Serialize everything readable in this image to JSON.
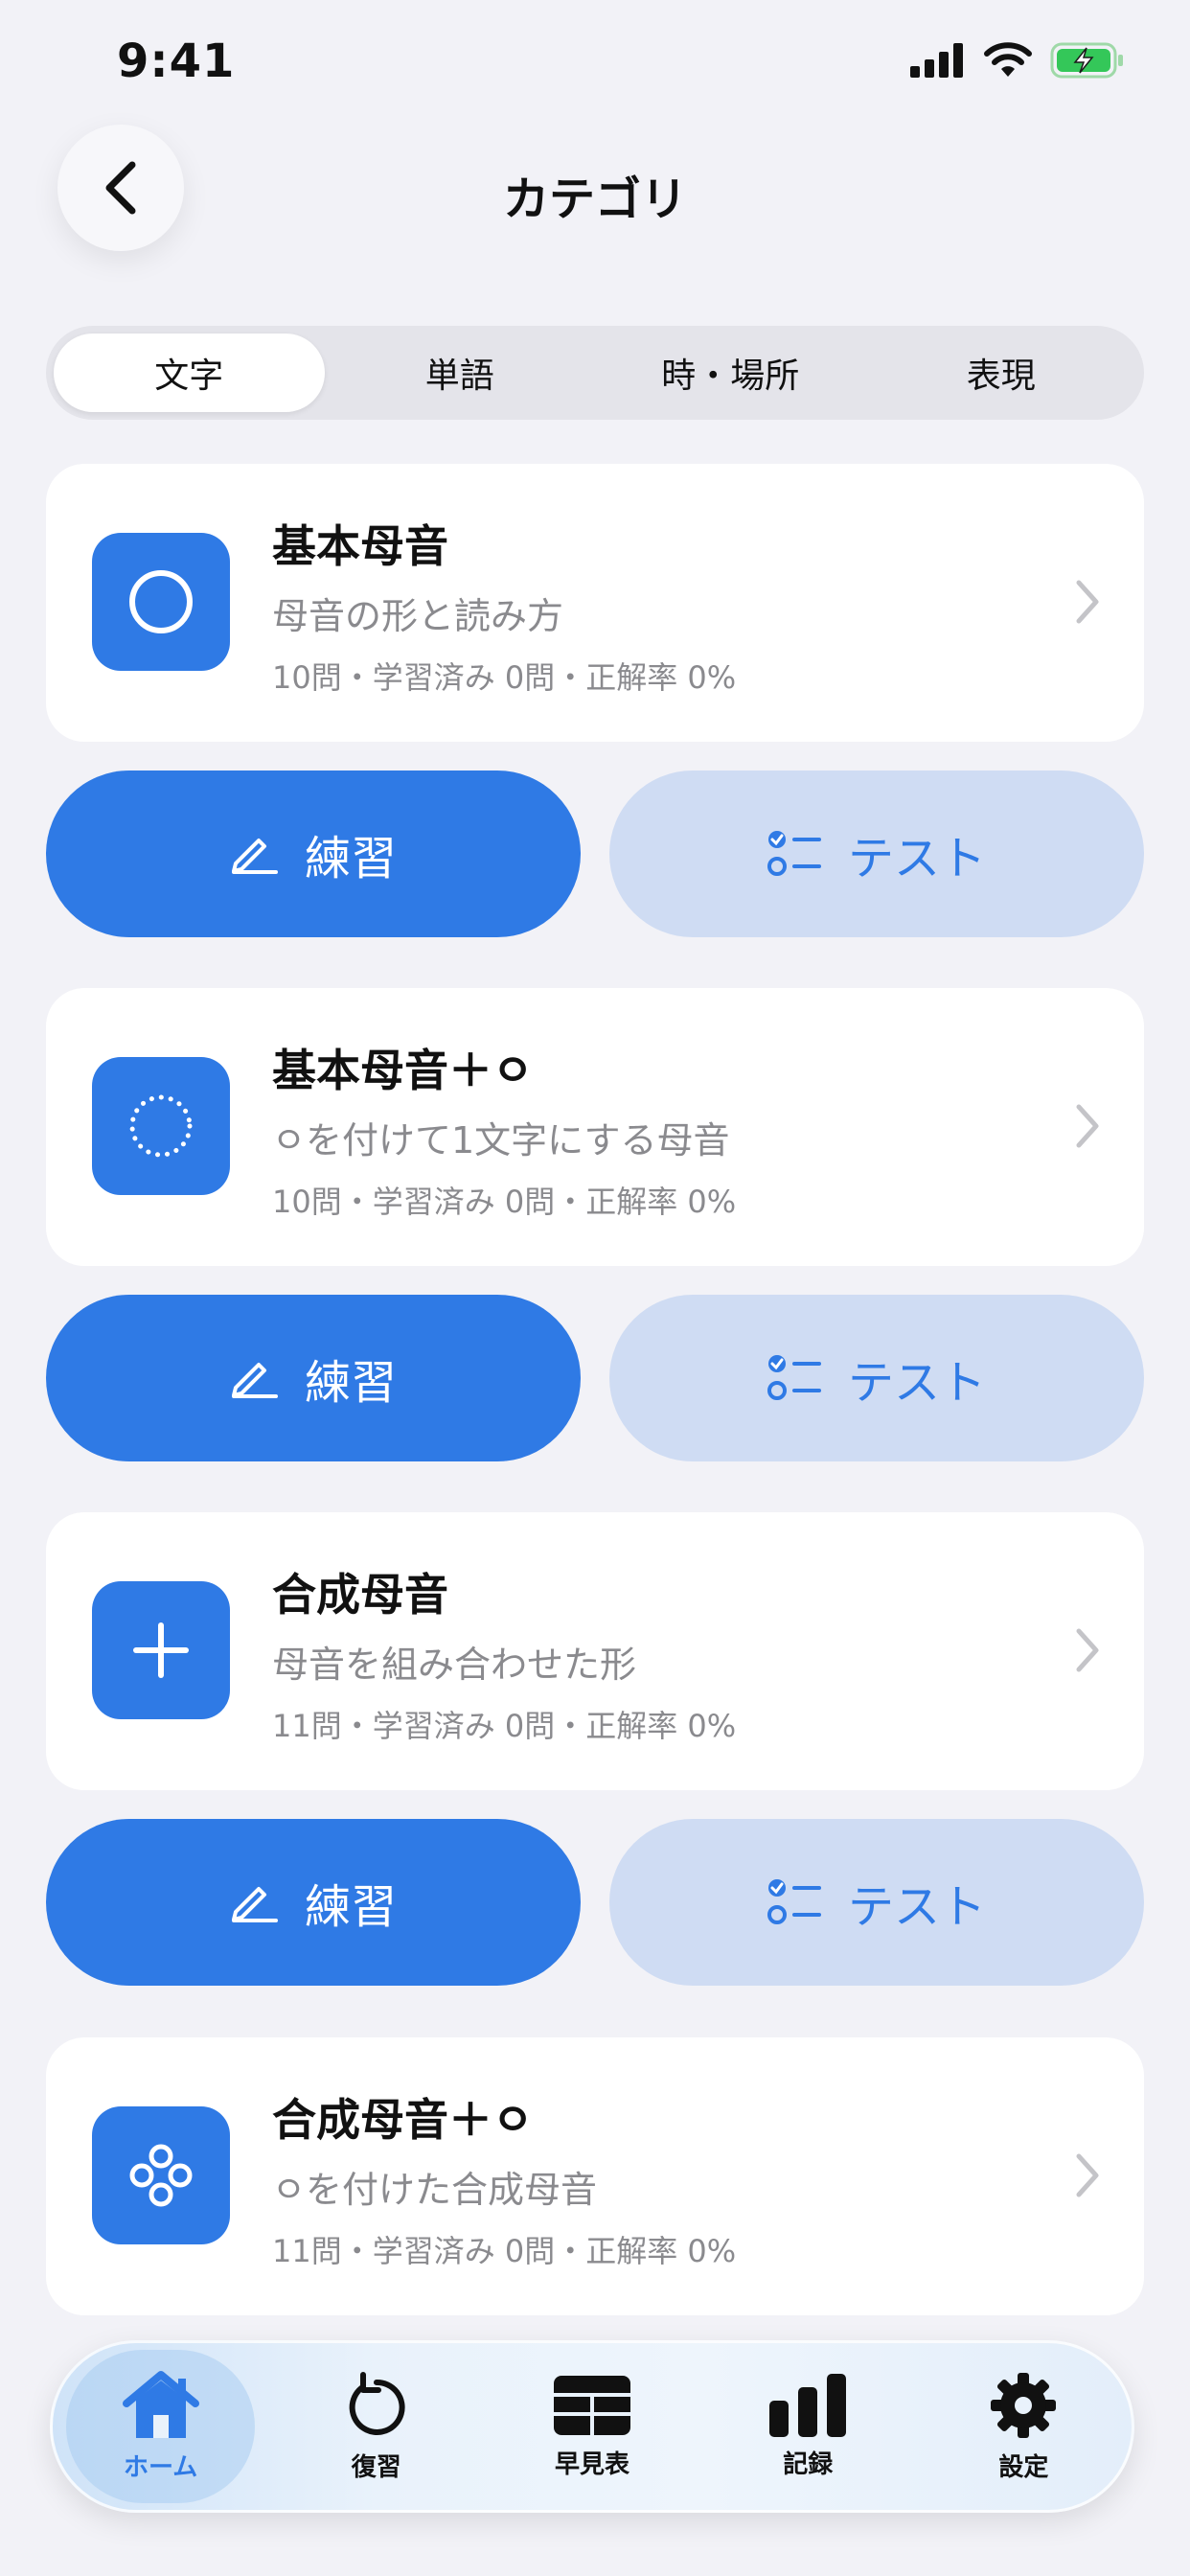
{
  "status_bar": {
    "time": "9:41"
  },
  "header": {
    "title": "カテゴリ"
  },
  "segments": [
    {
      "label": "文字"
    },
    {
      "label": "単語"
    },
    {
      "label": "時・場所"
    },
    {
      "label": "表現"
    }
  ],
  "categories": [
    {
      "title": "基本母音",
      "subtitle": "母音の形と読み方",
      "stats": "10問・学習済み 0問・正解率 0%",
      "icon": "circle-icon"
    },
    {
      "title": "基本母音＋ㅇ",
      "subtitle": "ㅇを付けて1文字にする母音",
      "stats": "10問・学習済み 0問・正解率 0%",
      "icon": "dotted-circle-icon"
    },
    {
      "title": "合成母音",
      "subtitle": "母音を組み合わせた形",
      "stats": "11問・学習済み 0問・正解率 0%",
      "icon": "plus-icon"
    },
    {
      "title": "合成母音＋ㅇ",
      "subtitle": "ㅇを付けた合成母音",
      "stats": "11問・学習済み 0問・正解率 0%",
      "icon": "four-circles-icon"
    }
  ],
  "actions": {
    "practice_label": "練習",
    "test_label": "テスト"
  },
  "tab_bar": [
    {
      "label": "ホーム",
      "icon": "house-icon"
    },
    {
      "label": "復習",
      "icon": "rotate-icon"
    },
    {
      "label": "早見表",
      "icon": "table-icon"
    },
    {
      "label": "記録",
      "icon": "bar-chart-icon"
    },
    {
      "label": "設定",
      "icon": "gear-icon"
    }
  ],
  "colors": {
    "accent": "#2f7ae5",
    "test_bg": "#cfdcf3",
    "background": "#f2f2f7",
    "battery": "#34c759"
  }
}
